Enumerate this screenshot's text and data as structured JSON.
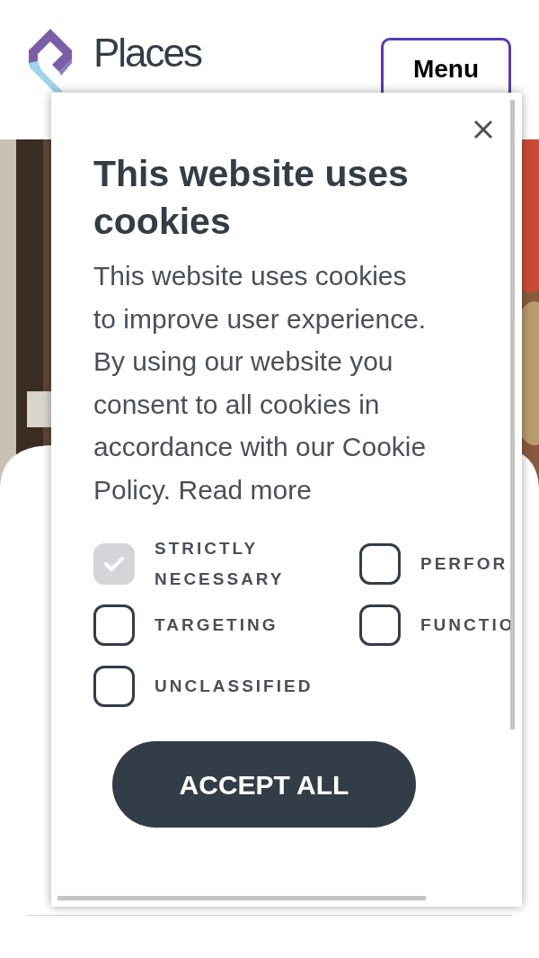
{
  "header": {
    "logo": {
      "line_1": "Places"
    },
    "menu_button": "Menu"
  },
  "cookie_dialog": {
    "title": "This website uses cookies",
    "body": "This website uses cookies to improve user experience. By using our website you consent to all cookies in accordance with our Cookie Policy. Read more",
    "options": [
      {
        "label": "STRICTLY NECESSARY",
        "checked": true,
        "disabled": true
      },
      {
        "label": "PERFOR",
        "checked": false,
        "disabled": false
      },
      {
        "label": "TARGETING",
        "checked": false,
        "disabled": false
      },
      {
        "label": "FUNCTIO",
        "checked": false,
        "disabled": false
      },
      {
        "label": "UNCLASSIFIED",
        "checked": false,
        "disabled": false
      }
    ],
    "accept_button": "ACCEPT ALL"
  }
}
